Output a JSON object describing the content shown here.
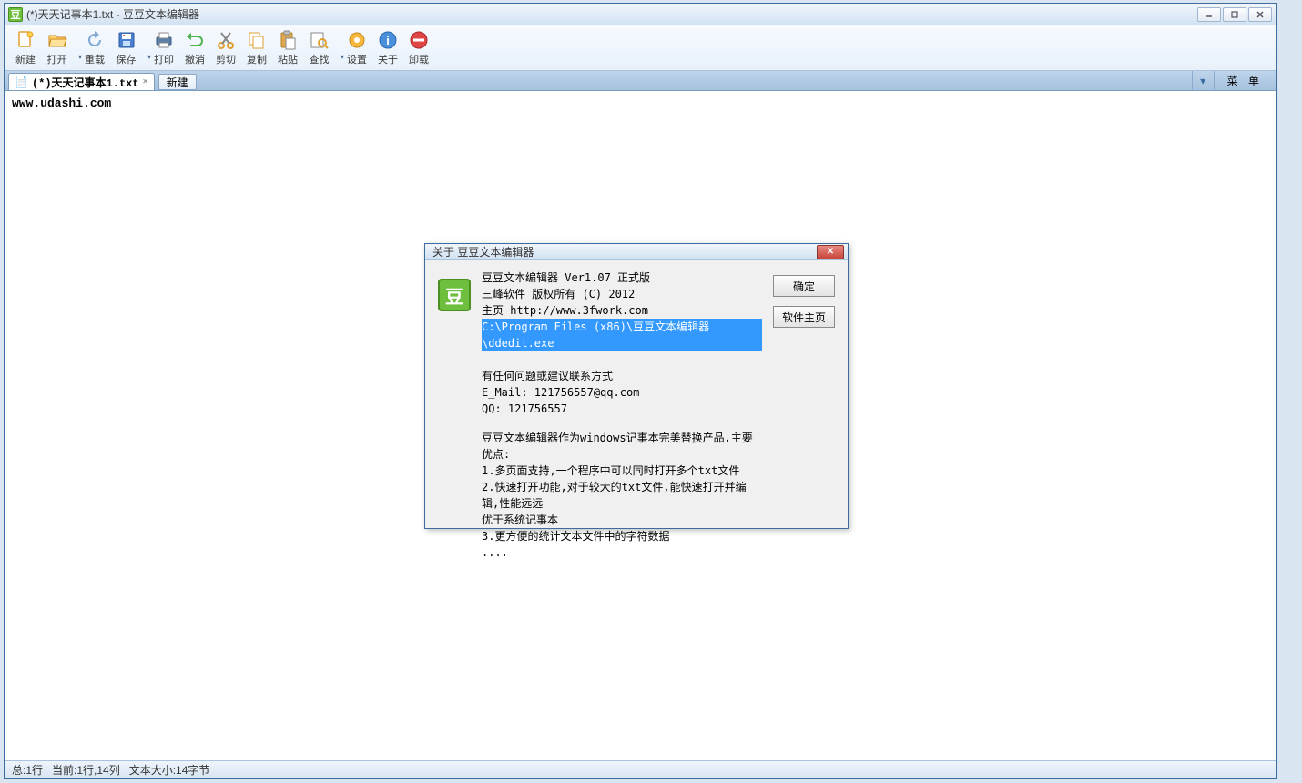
{
  "window": {
    "title": "(*)天天记事本1.txt - 豆豆文本编辑器"
  },
  "toolbar": {
    "new_label": "新建",
    "open_label": "打开",
    "reload_label": "重载",
    "save_label": "保存",
    "print_label": "打印",
    "undo_label": "撤消",
    "cut_label": "剪切",
    "copy_label": "复制",
    "paste_label": "粘贴",
    "find_label": "查找",
    "settings_label": "设置",
    "about_label": "关于",
    "uninstall_label": "卸载"
  },
  "tabs": {
    "active_label": "(*)天天记事本1.txt",
    "new_tab_btn": "新建",
    "menu_label": "菜 单"
  },
  "editor": {
    "content": "www.udashi.com"
  },
  "statusbar": {
    "total": "总:1行",
    "current": "当前:1行,14列",
    "size": "文本大小:14字节"
  },
  "dialog": {
    "title": "关于  豆豆文本编辑器",
    "line1": "豆豆文本编辑器 Ver1.07 正式版",
    "line2": "三峰软件 版权所有 (C) 2012",
    "line3": "主页 http://www.3fwork.com",
    "line_path": "C:\\Program Files (x86)\\豆豆文本编辑器\\ddedit.exe",
    "contact_hdr": "有任何问题或建议联系方式",
    "email": "E_Mail: 121756557@qq.com",
    "qq": "QQ: 121756557",
    "desc1": "豆豆文本编辑器作为windows记事本完美替换产品,主要优点:",
    "desc2": "1.多页面支持,一个程序中可以同时打开多个txt文件",
    "desc3": "2.快速打开功能,对于较大的txt文件,能快速打开并编辑,性能远远",
    "desc4": "优于系统记事本",
    "desc5": "3.更方便的统计文本文件中的字符数据",
    "desc6": "....",
    "ok_label": "确定",
    "home_label": "软件主页"
  }
}
